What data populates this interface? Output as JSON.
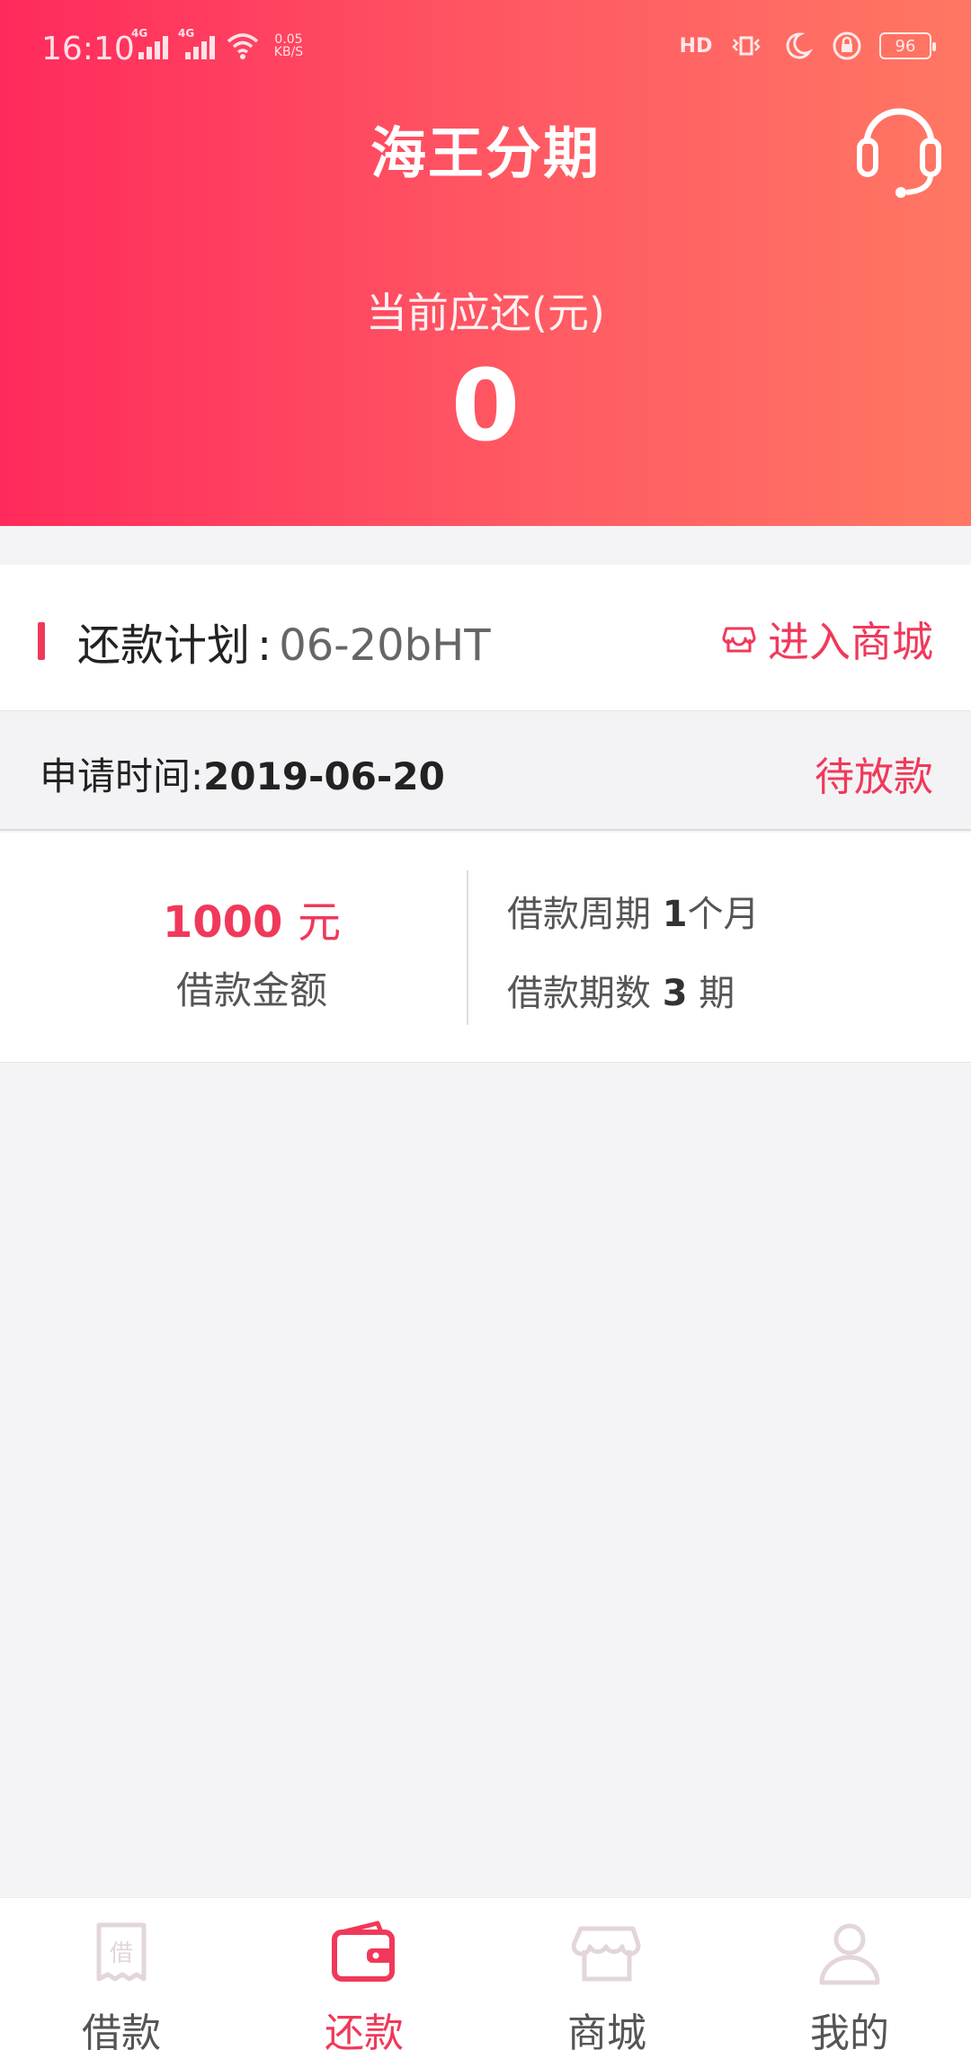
{
  "status_bar": {
    "time": "16:10",
    "net_speed_value": "0.05",
    "net_speed_unit": "KB/S",
    "sim1_tag": "4G",
    "sim2_tag": "4G",
    "hd_label": "HD",
    "battery": "96"
  },
  "header": {
    "title": "海王分期",
    "due_label": "当前应还(元)",
    "due_amount": "0"
  },
  "plan": {
    "title": "还款计划",
    "separator": ":",
    "code": "06-20bHT",
    "mall_link": "进入商城"
  },
  "application": {
    "time_label": "申请时间:",
    "date": "2019-06-20",
    "status": "待放款"
  },
  "loan": {
    "amount": "1000",
    "amount_unit": "元",
    "amount_label": "借款金额",
    "period_label": "借款周期",
    "period_value": "1",
    "period_unit": "个月",
    "terms_label": "借款期数",
    "terms_value": "3",
    "terms_unit": "期"
  },
  "bottom_nav": {
    "items": [
      {
        "label": "借款",
        "icon": "borrow-receipt-icon",
        "active": false
      },
      {
        "label": "还款",
        "icon": "wallet-icon",
        "active": true
      },
      {
        "label": "商城",
        "icon": "store-icon",
        "active": false
      },
      {
        "label": "我的",
        "icon": "user-icon",
        "active": false
      }
    ]
  },
  "colors": {
    "accent": "#f0395a",
    "header_gradient_start": "#ff2a5c",
    "header_gradient_end": "#ff7763"
  }
}
